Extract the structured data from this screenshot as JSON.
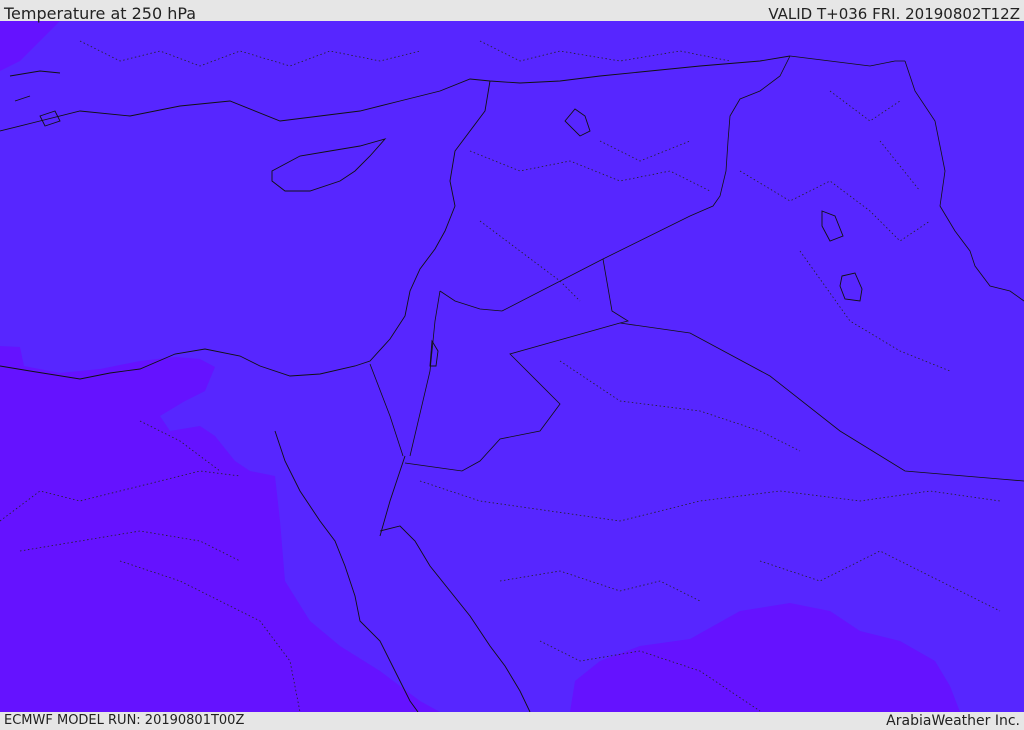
{
  "header": {
    "title": "Temperature at 250 hPa",
    "valid": "VALID T+036 FRI. 20190802T12Z"
  },
  "footer": {
    "model_run": "ECMWF MODEL RUN: 20190801T00Z",
    "credit": "ArabiaWeather Inc."
  },
  "colors": {
    "field_main": "#5726ff",
    "field_warm": "#6512ff",
    "coastline": "#111111",
    "header_bg": "#e6e6e6"
  }
}
